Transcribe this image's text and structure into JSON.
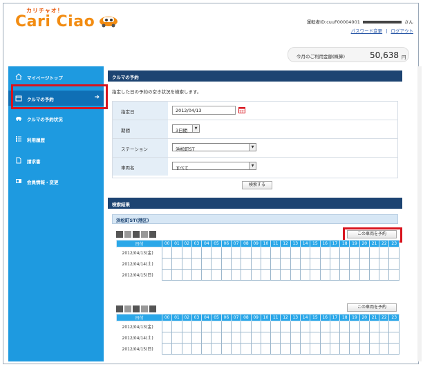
{
  "header": {
    "logo_small": "カリチャオ！",
    "logo_main": "Cari Ciao",
    "user_prefix": "運転者ID:cuuF00004001",
    "user_suffix": "さん",
    "password_link": "パスワード変更",
    "separator": "|",
    "logout_link": "ログアウト"
  },
  "usage": {
    "label": "今月のご利用金額(概算)",
    "value": "50,638",
    "unit": "円"
  },
  "sidebar": {
    "items": [
      {
        "label": "マイページトップ",
        "icon": "home-icon"
      },
      {
        "label": "クルマの予約",
        "icon": "calendar-icon",
        "active": true
      },
      {
        "label": "クルマの予約状況",
        "icon": "car-icon"
      },
      {
        "label": "利用履歴",
        "icon": "list-icon"
      },
      {
        "label": "請求書",
        "icon": "document-icon"
      },
      {
        "label": "会員情報・変更",
        "icon": "member-card-icon"
      }
    ]
  },
  "reservation": {
    "title": "クルマの予約",
    "description": "指定した日の予約の空き状況を検索します。",
    "fields": {
      "date_label": "指定日",
      "date_value": "2012/04/13",
      "period_label": "期間",
      "period_value": "3日間",
      "station_label": "ステーション",
      "station_value": "浜松町ST",
      "car_label": "車両名",
      "car_value": "すべて"
    },
    "search_button": "検索する"
  },
  "results": {
    "title": "検索結果",
    "station": "浜松町ST(港区)",
    "reserve_button": "この車両を予約",
    "date_header": "日付",
    "hours": [
      "00",
      "01",
      "02",
      "03",
      "04",
      "05",
      "06",
      "07",
      "08",
      "09",
      "10",
      "11",
      "12",
      "13",
      "14",
      "15",
      "16",
      "17",
      "18",
      "19",
      "20",
      "21",
      "22",
      "23"
    ],
    "dates": [
      "2012/04/13(金)",
      "2012/04/14(土)",
      "2012/04/15(日)"
    ]
  },
  "colors": {
    "sidebar": "#1e9ae0",
    "sidebar_active": "#0f6fb5",
    "section_header": "#1d4472",
    "highlight_frame": "#d8141e",
    "schedule_header": "#2aa7e8",
    "logo": "#f28c12"
  }
}
